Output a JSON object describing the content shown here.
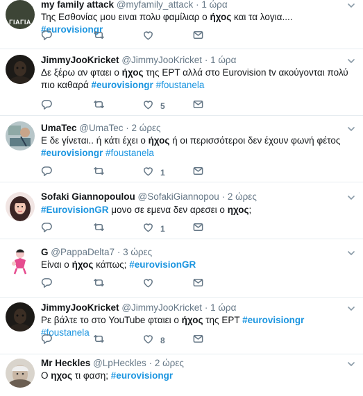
{
  "colors": {
    "link": "#1b95e0",
    "muted": "#657786",
    "divider": "#e6ecf0"
  },
  "tweets": [
    {
      "name": "my family attack",
      "handle": "@myfamily_attack",
      "dot": "·",
      "time": "1 ώρα",
      "avatar": {
        "type": "text-badge",
        "label": "ΓΙΑΓΙΑ"
      },
      "segments": [
        {
          "t": "Της Εσθονίας μου ειναι πολυ φαμίλιαρ ο ",
          "s": "p"
        },
        {
          "t": "ήχος",
          "s": "b"
        },
        {
          "t": " και τα λογια.... ",
          "s": "p"
        },
        {
          "t": "#eurovisiongr",
          "s": "tb"
        }
      ],
      "likes": ""
    },
    {
      "name": "JimmyJooKricket",
      "handle": "@JimmyJooKricket",
      "dot": "·",
      "time": "1 ώρα",
      "avatar": {
        "type": "dark-face"
      },
      "segments": [
        {
          "t": "Δε ξέρω αν φταει ο ",
          "s": "p"
        },
        {
          "t": "ήχος",
          "s": "b"
        },
        {
          "t": " της ΕΡΤ αλλά στο Eurovision tv ακούγονται πολύ πιο καθαρά ",
          "s": "p"
        },
        {
          "t": "#eurovisiongr",
          "s": "tb"
        },
        {
          "t": " ",
          "s": "p"
        },
        {
          "t": "#foustanela",
          "s": "t"
        }
      ],
      "likes": "5"
    },
    {
      "name": "UmaTec",
      "handle": "@UmaTec",
      "dot": "·",
      "time": "2 ώρες",
      "avatar": {
        "type": "painting"
      },
      "segments": [
        {
          "t": "Ε δε γίνεται.. ή κάτι έχει ο ",
          "s": "p"
        },
        {
          "t": "ήχος",
          "s": "b"
        },
        {
          "t": " ή οι περισσότεροι δεν έχουν φωνή φέτος ",
          "s": "p"
        },
        {
          "t": "#eurovisiongr",
          "s": "tb"
        },
        {
          "t": " ",
          "s": "p"
        },
        {
          "t": "#foustanela",
          "s": "t"
        }
      ],
      "likes": "1"
    },
    {
      "name": "Sofaki Giannopoulou",
      "handle": "@SofakiGiannopou",
      "dot": "·",
      "time": "2 ώρες",
      "avatar": {
        "type": "girl"
      },
      "segments": [
        {
          "t": "#EurovisionGR",
          "s": "tb"
        },
        {
          "t": " μονο σε εμενα δεν αρεσει ο ",
          "s": "p"
        },
        {
          "t": "ηχος",
          "s": "b"
        },
        {
          "t": ";",
          "s": "p"
        }
      ],
      "likes": "1"
    },
    {
      "name": "G",
      "handle": "@PappaDelta7",
      "dot": "·",
      "time": "3 ώρες",
      "avatar": {
        "type": "cartoon"
      },
      "segments": [
        {
          "t": "Είναι ο ",
          "s": "p"
        },
        {
          "t": "ήχος",
          "s": "b"
        },
        {
          "t": " κάπως; ",
          "s": "p"
        },
        {
          "t": "#eurovisionGR",
          "s": "tb"
        }
      ],
      "likes": ""
    },
    {
      "name": "JimmyJooKricket",
      "handle": "@JimmyJooKricket",
      "dot": "·",
      "time": "1 ώρα",
      "avatar": {
        "type": "dark-face"
      },
      "segments": [
        {
          "t": "Ρε βάλτε το στο YouTube φταιει ο ",
          "s": "p"
        },
        {
          "t": "ήχος",
          "s": "b"
        },
        {
          "t": " της ΕΡΤ ",
          "s": "p"
        },
        {
          "t": "#eurovisiongr",
          "s": "tb"
        },
        {
          "t": " ",
          "s": "p"
        },
        {
          "t": "#foustanela",
          "s": "t"
        }
      ],
      "likes": "8"
    },
    {
      "name": "Mr Heckles",
      "handle": "@LpHeckles",
      "dot": "·",
      "time": "2 ώρες",
      "avatar": {
        "type": "old-man"
      },
      "segments": [
        {
          "t": "Ο ",
          "s": "p"
        },
        {
          "t": "ηχος",
          "s": "b"
        },
        {
          "t": " τι φαση; ",
          "s": "p"
        },
        {
          "t": "#eurovisiongr",
          "s": "tb"
        }
      ],
      "likes": ""
    }
  ]
}
